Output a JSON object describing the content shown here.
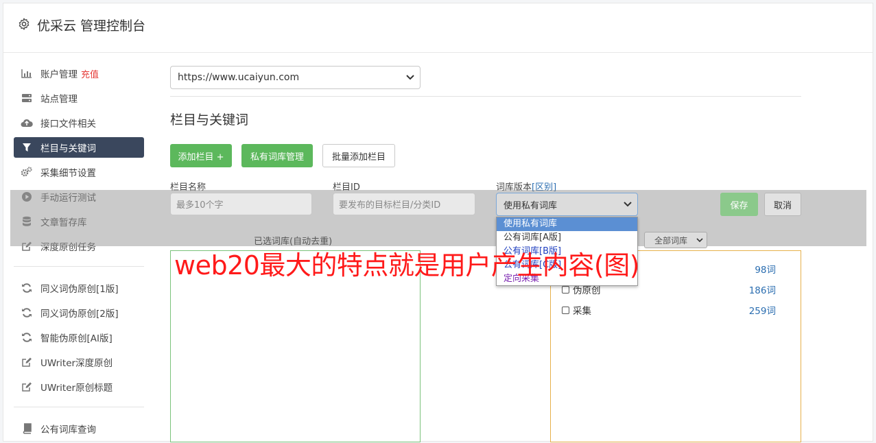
{
  "header": {
    "title": "优采云 管理控制台",
    "icon": "gear-icon"
  },
  "sidebar": {
    "items": [
      {
        "label": "账户管理",
        "badge": "充值",
        "icon": "bar-chart-icon"
      },
      {
        "label": "站点管理",
        "icon": "server-icon"
      },
      {
        "label": "接口文件相关",
        "icon": "cloud-upload-icon"
      },
      {
        "label": "栏目与关键词",
        "icon": "filter-icon",
        "active": true
      },
      {
        "label": "采集细节设置",
        "icon": "cogs-icon"
      },
      {
        "label": "手动运行测试",
        "icon": "play-circle-icon"
      },
      {
        "label": "文章暂存库",
        "icon": "database-icon"
      },
      {
        "label": "深度原创任务",
        "icon": "edit-icon"
      }
    ],
    "group2": [
      {
        "label": "同义词伪原创[1版]",
        "icon": "refresh-icon"
      },
      {
        "label": "同义词伪原创[2版]",
        "icon": "refresh-icon"
      },
      {
        "label": "智能伪原创[AI版]",
        "icon": "refresh-icon"
      },
      {
        "label": "UWriter深度原创",
        "icon": "edit-icon"
      },
      {
        "label": "UWriter原创标题",
        "icon": "edit-icon"
      }
    ],
    "group3": [
      {
        "label": "公有词库查询",
        "icon": "book-icon"
      }
    ]
  },
  "main": {
    "site_select": "https://www.ucaiyun.com",
    "section_title": "栏目与关键词",
    "buttons": {
      "add_column": "添加栏目 +",
      "private_lib": "私有词库管理",
      "batch_add": "批量添加栏目"
    },
    "form": {
      "name_label": "栏目名称",
      "name_placeholder": "最多10个字",
      "id_label": "栏目ID",
      "id_placeholder": "要发布的目标栏目/分类ID",
      "lib_label": "词库版本",
      "lib_link": "[区别]",
      "lib_selected": "使用私有词库",
      "save": "保存",
      "cancel": "取消"
    },
    "dropdown_options": [
      "使用私有词库",
      "公有词库[A版]",
      "公有词库[B版]",
      "公有词库[C版]",
      "定向采集"
    ],
    "selected_label": "已选词库(自动去重)",
    "filter_select": "全部词库",
    "libraries": [
      {
        "name": "",
        "count": "98词"
      },
      {
        "name": "伪原创",
        "count": "186词"
      },
      {
        "name": "采集",
        "count": "259词"
      }
    ]
  },
  "watermark": "web20最大的特点就是用户产生内容(图)",
  "colors": {
    "accent_green": "#5cb85c",
    "active_nav": "#3a475d",
    "badge_red": "#e53935",
    "watermark_red": "#ff1a1a"
  }
}
